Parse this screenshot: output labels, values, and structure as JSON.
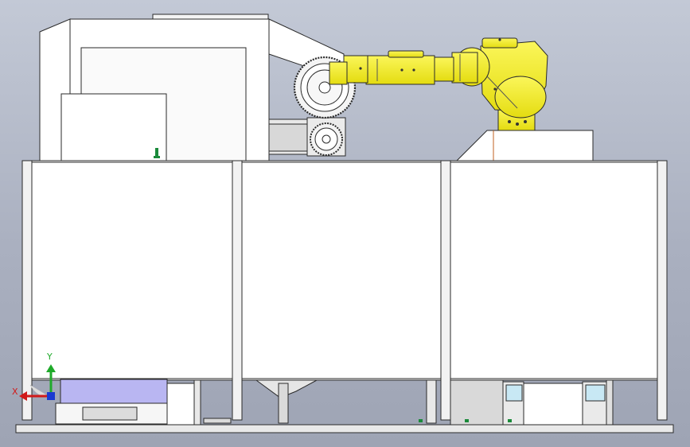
{
  "viewport": {
    "background_top": "#c3c9d6",
    "background_bottom": "#9ea4b4"
  },
  "model": {
    "frame_color": "#ffffff",
    "edge_color": "#2a2a2a",
    "robot_color": "#f5f024",
    "window_color": "#b9b6f2",
    "accent_color": "#1a8a3a"
  },
  "triad": {
    "x_label": "X",
    "y_label": "Y",
    "x_color": "#d11a1a",
    "y_color": "#1faa2a",
    "origin_color": "#1a3ad1",
    "icon_name": "coordinate-triad-icon"
  }
}
